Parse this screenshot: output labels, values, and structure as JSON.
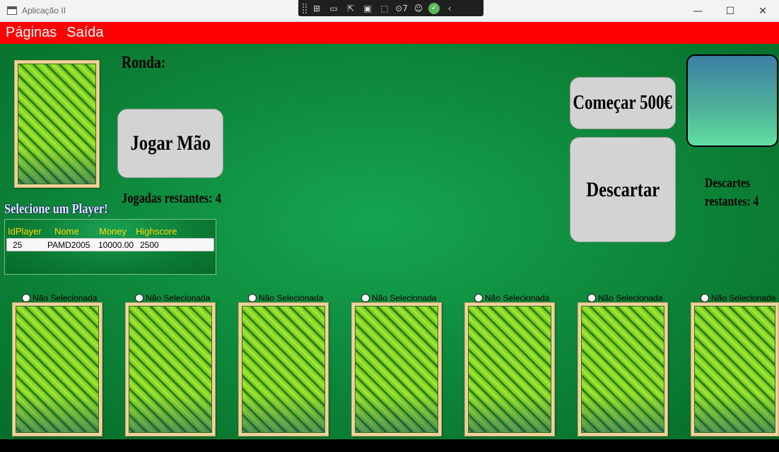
{
  "window": {
    "title": "Aplicação II",
    "minimize": "—",
    "maximize": "☐",
    "close": "✕"
  },
  "debug_toolbar": {
    "badge": "7"
  },
  "menu": {
    "items": [
      "Páginas",
      "Saída"
    ]
  },
  "game": {
    "round_label": "Ronda:",
    "play_button": "Jogar Mão",
    "plays_remaining": "Jogadas restantes: 4",
    "start_button": "Começar 500€",
    "discard_button": "Descartar",
    "discards_line1": "Descartes",
    "discards_line2": "restantes: 4"
  },
  "player_select": {
    "title": "Selecione um Player!",
    "columns": [
      "IdPlayer",
      "Nome",
      "Money",
      "Highscore"
    ],
    "rows": [
      [
        "25",
        "PAMD2005",
        "10000.00",
        "2500"
      ]
    ]
  },
  "hand": {
    "cards": [
      {
        "status": "Não Selecionada"
      },
      {
        "status": "Não Selecionada"
      },
      {
        "status": "Não Selecionada"
      },
      {
        "status": "Não Selecionada"
      },
      {
        "status": "Não Selecionada"
      },
      {
        "status": "Não Selecionada"
      },
      {
        "status": "Não Selecionada"
      }
    ]
  }
}
